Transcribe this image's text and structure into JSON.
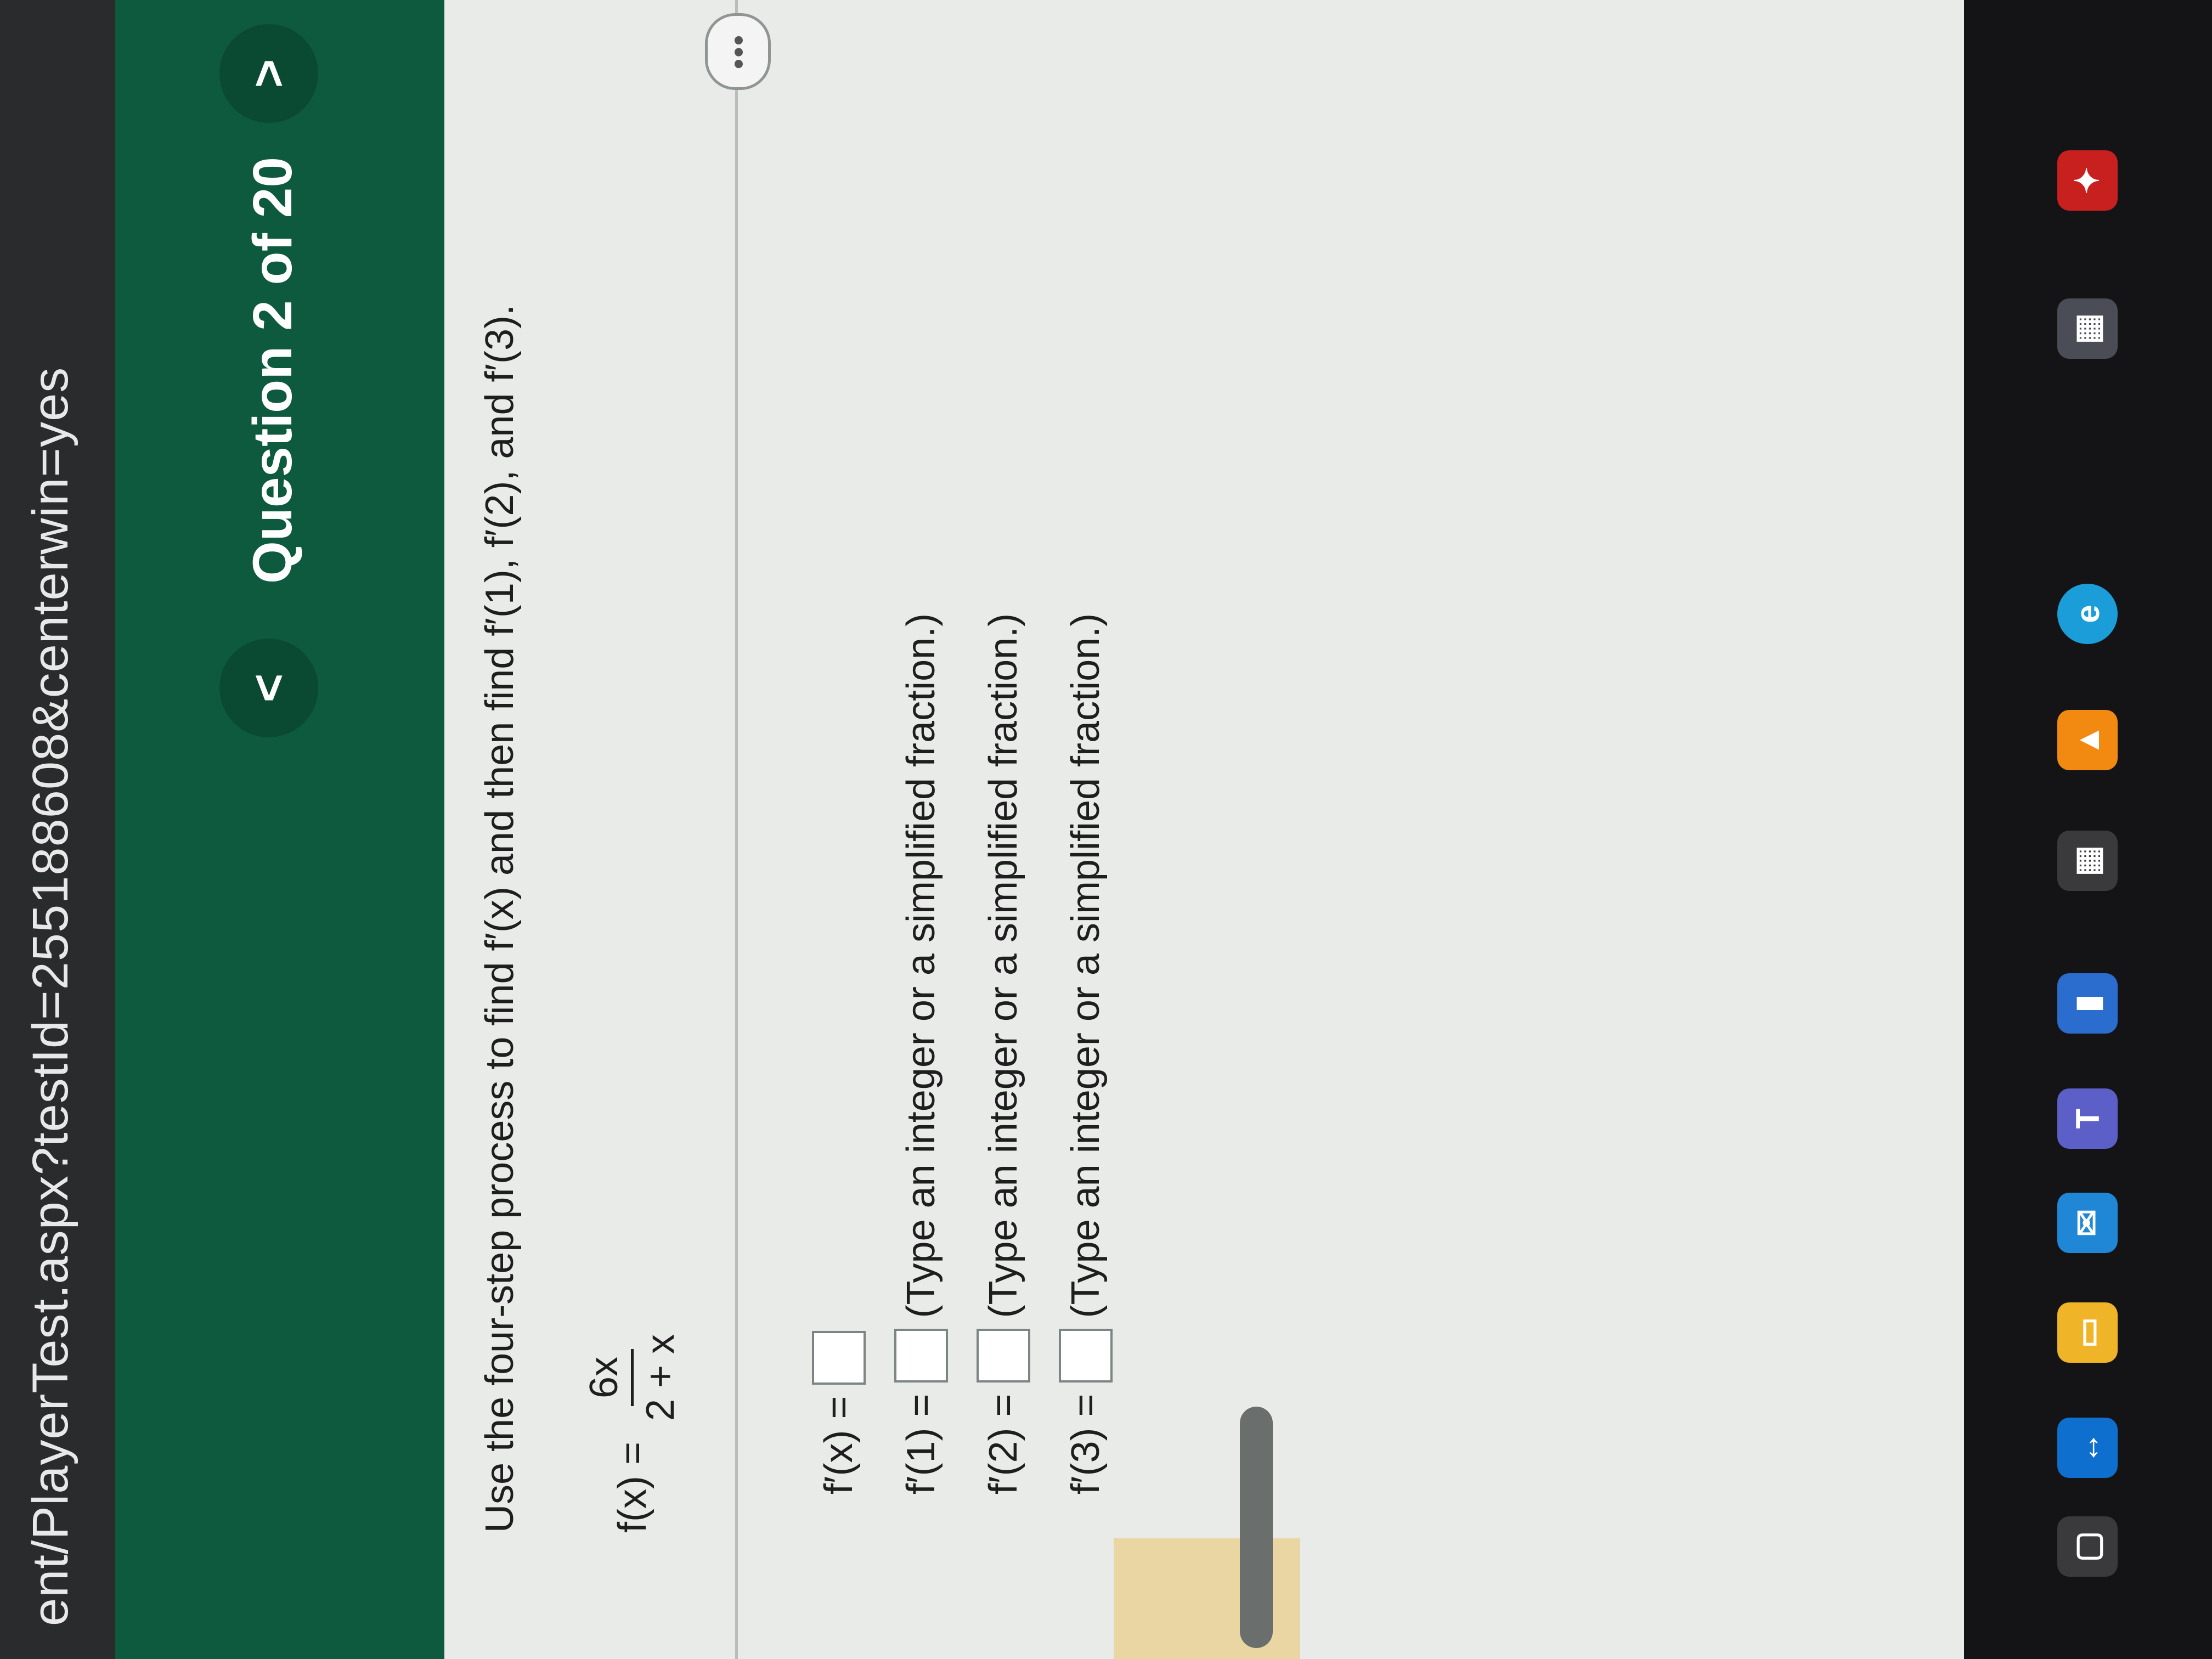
{
  "browser": {
    "url": "ent/PlayerTest.aspx?testId=255188608&centerwin=yes"
  },
  "header": {
    "question_label": "Question 2 of 20",
    "prev": "<",
    "next": ">"
  },
  "question": {
    "prompt": "Use the four-step process to find f′(x) and then find f′(1), f′(2), and f′(3).",
    "function_lhs": "f(x) =",
    "numerator": "6x",
    "denominator": "2 + x",
    "more_label": "•••"
  },
  "answers": [
    {
      "label": "f′(x) =",
      "hint": ""
    },
    {
      "label": "f′(1) =",
      "hint": "(Type an integer or a simplified fraction.)"
    },
    {
      "label": "f′(2) =",
      "hint": "(Type an integer or a simplified fraction.)"
    },
    {
      "label": "f′(3) =",
      "hint": "(Type an integer or a simplified fraction.)"
    }
  ],
  "taskbar": {
    "icons": [
      "task-view-icon",
      "teamviewer-icon",
      "file-explorer-icon",
      "mail-icon",
      "teams-icon",
      "app-icon",
      "store-icon",
      "vlc-icon",
      "edge-icon",
      "calculator-icon",
      "acrobat-icon"
    ]
  }
}
